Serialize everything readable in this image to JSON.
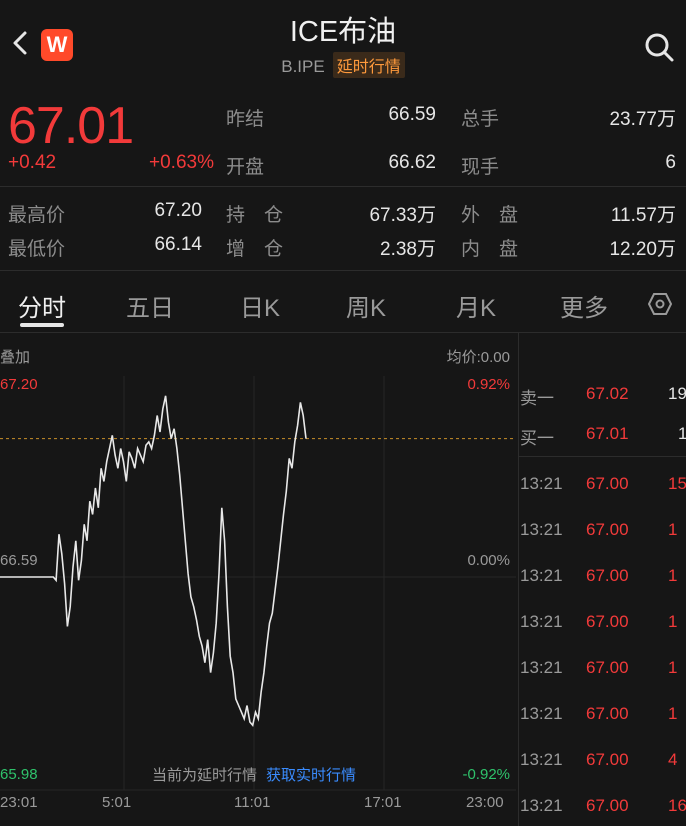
{
  "header": {
    "title": "ICE布油",
    "code": "B.IPE",
    "delay_tag": "延时行情",
    "logo_letter": "W"
  },
  "quote": {
    "price": "67.01",
    "change": "+0.42",
    "change_pct": "+0.63%",
    "prev_close_label": "昨结",
    "prev_close": "66.59",
    "volume_label": "总手",
    "volume": "23.77万",
    "open_label": "开盘",
    "open": "66.62",
    "cur_vol_label": "现手",
    "cur_vol": "6",
    "high_label": "最高价",
    "high": "67.20",
    "oi_label": "持　仓",
    "oi": "67.33万",
    "outer_label": "外　盘",
    "outer": "11.57万",
    "low_label": "最低价",
    "low": "66.14",
    "oi_chg_label": "增　仓",
    "oi_chg": "2.38万",
    "inner_label": "内　盘",
    "inner": "12.20万"
  },
  "tabs": [
    "分时",
    "五日",
    "日K",
    "周K",
    "月K",
    "更多"
  ],
  "chart": {
    "overlay_label": "叠加",
    "avg_label": "均价:0.00",
    "y_top": "67.20",
    "y_mid": "66.59",
    "y_bottom": "65.98",
    "pct_top": "0.92%",
    "pct_mid": "0.00%",
    "pct_bottom": "-0.92%",
    "notice": "当前为延时行情",
    "notice_link": "获取实时行情",
    "x_ticks": [
      "23:01",
      "5:01",
      "11:01",
      "17:01",
      "23:00"
    ]
  },
  "chart_data": {
    "type": "line",
    "title": "",
    "xlabel": "",
    "ylabel": "",
    "ylim": [
      65.98,
      67.2
    ],
    "prev_close": 66.59,
    "current": 67.01,
    "series": [
      {
        "values": [
          66.59,
          66.59,
          66.59,
          66.59,
          66.59,
          66.59,
          66.59,
          66.59,
          66.59,
          66.59,
          66.59,
          66.59,
          66.59,
          66.59,
          66.59,
          66.59,
          66.59,
          66.59,
          66.59,
          66.59,
          66.58,
          66.72,
          66.66,
          66.57,
          66.44,
          66.5,
          66.62,
          66.7,
          66.58,
          66.64,
          66.75,
          66.7,
          66.82,
          66.78,
          66.86,
          66.8,
          66.92,
          66.88,
          66.94,
          66.98,
          67.02,
          66.96,
          66.92,
          66.98,
          66.94,
          66.88,
          66.97,
          66.95,
          66.92,
          66.98,
          66.96,
          66.94,
          66.99,
          67.0,
          66.98,
          67.02,
          67.08,
          67.03,
          67.1,
          67.14,
          67.06,
          67.01,
          67.04,
          66.98,
          66.9,
          66.8,
          66.7,
          66.6,
          66.53,
          66.5,
          66.46,
          66.41,
          66.38,
          66.33,
          66.4,
          66.3,
          66.36,
          66.45,
          66.6,
          66.8,
          66.7,
          66.5,
          66.35,
          66.3,
          66.22,
          66.2,
          66.18,
          66.16,
          66.2,
          66.15,
          66.14,
          66.18,
          66.16,
          66.24,
          66.3,
          66.38,
          66.45,
          66.48,
          66.55,
          66.62,
          66.7,
          66.78,
          66.85,
          66.95,
          66.92,
          67.0,
          67.05,
          67.12,
          67.08,
          67.01
        ]
      }
    ]
  },
  "orderbook": {
    "ask_label": "卖一",
    "ask_price": "67.02",
    "ask_vol": "19",
    "bid_label": "买一",
    "bid_price": "67.01",
    "bid_vol": "1",
    "ticks": [
      {
        "time": "13:21",
        "price": "67.00",
        "vol": "15"
      },
      {
        "time": "13:21",
        "price": "67.00",
        "vol": "1"
      },
      {
        "time": "13:21",
        "price": "67.00",
        "vol": "1"
      },
      {
        "time": "13:21",
        "price": "67.00",
        "vol": "1"
      },
      {
        "time": "13:21",
        "price": "67.00",
        "vol": "1"
      },
      {
        "time": "13:21",
        "price": "67.00",
        "vol": "1"
      },
      {
        "time": "13:21",
        "price": "67.00",
        "vol": "4"
      },
      {
        "time": "13:21",
        "price": "67.00",
        "vol": "16"
      }
    ]
  },
  "colors": {
    "up": "#f23a3a",
    "down": "#2fc26b",
    "bg": "#161616",
    "accent": "#ff9a3c",
    "link": "#3a8cff"
  }
}
